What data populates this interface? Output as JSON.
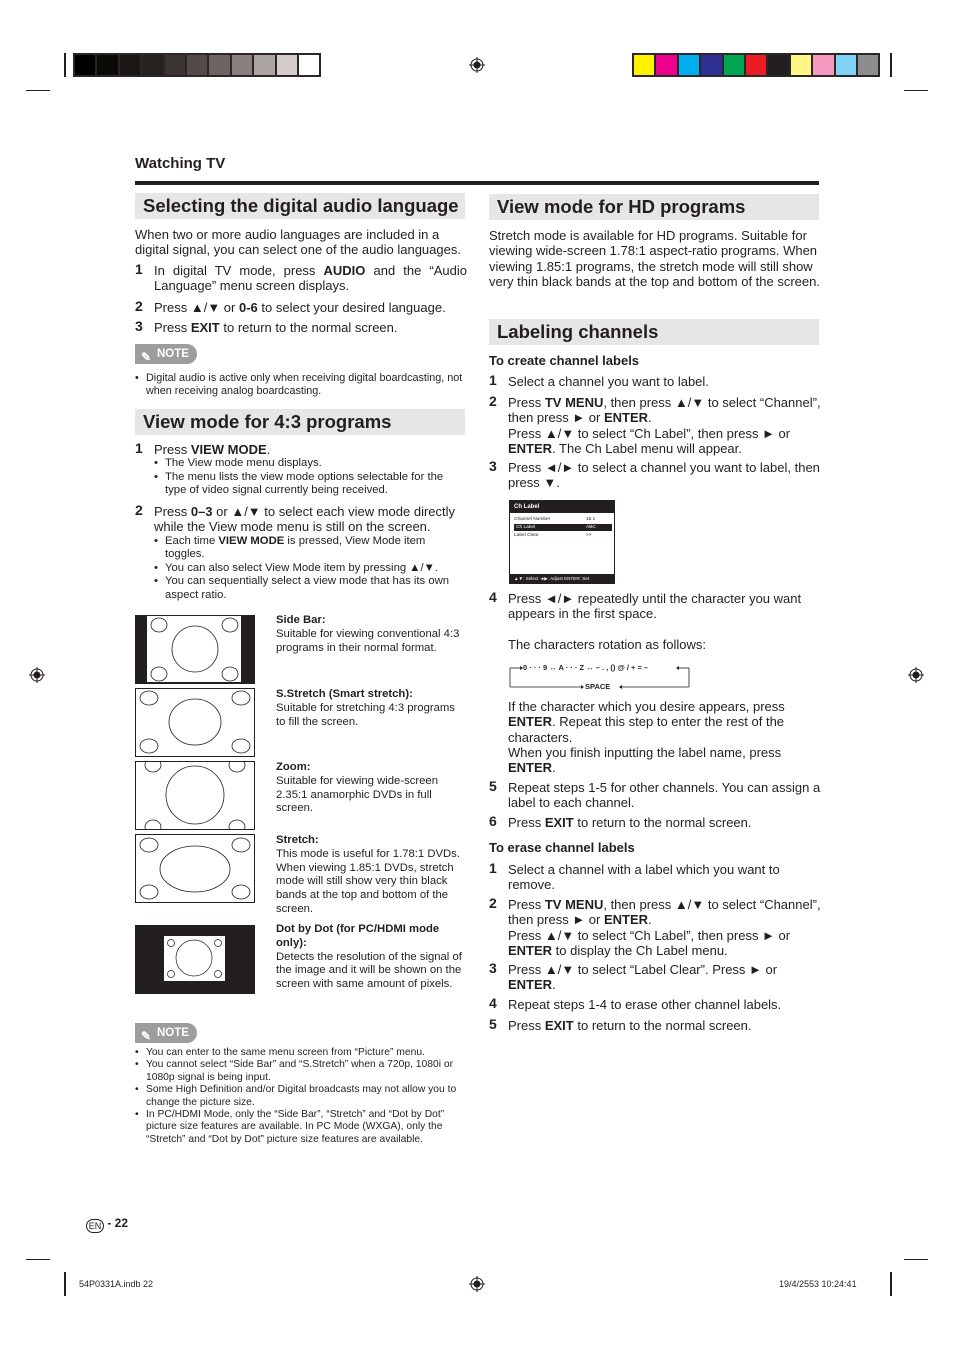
{
  "print_marks": {
    "gray_swatches": [
      "#000000",
      "#0c0a09",
      "#1a1615",
      "#262220",
      "#3b3432",
      "#544b48",
      "#6d6360",
      "#8a807c",
      "#aca4a1",
      "#d4cdcc",
      "#ffffff"
    ],
    "color_swatches": [
      "#fff100",
      "#ec008c",
      "#00aeef",
      "#2e3192",
      "#00a651",
      "#ed1c24",
      "#231f20",
      "#fff685",
      "#f49ac1",
      "#7fd3f7",
      "#8c8c8c"
    ]
  },
  "header": {
    "section": "Watching TV"
  },
  "left": {
    "audio": {
      "title": "Selecting the digital audio language",
      "intro": "When two or more audio languages are included in a digital signal, you can select one of the audio languages.",
      "steps": [
        {
          "n": "1",
          "pre": "In digital TV mode, press ",
          "key": "AUDIO",
          "post": " and the “Audio Language” menu screen displays."
        },
        {
          "n": "2",
          "pre": "Press ▲/▼ or ",
          "key": "0-6",
          "post": " to select your desired language."
        },
        {
          "n": "3",
          "pre": "Press ",
          "key": "EXIT",
          "post": " to return to the normal screen."
        }
      ],
      "note_label": "NOTE",
      "notes": [
        "Digital audio is active only when receiving digital boardcasting, not when receiving analog boardcasting."
      ]
    },
    "view43": {
      "title": "View mode for 4:3 programs",
      "step1": {
        "n": "1",
        "pre": "Press ",
        "key": "VIEW MODE",
        "post": ".",
        "bullets": [
          "The View mode menu displays.",
          "The menu lists the view mode options selectable for the type of video signal currently being received."
        ]
      },
      "step2": {
        "n": "2",
        "pre": "Press ",
        "key": "0–3",
        "post": " or ▲/▼ to select each view mode directly while the View mode menu is still on the screen.",
        "b1_pre": "Each time ",
        "b1_key": "VIEW MODE",
        "b1_post": " is pressed, View Mode item toggles.",
        "b2": "You can also select View Mode item by pressing ▲/▼.",
        "b3": "You can sequentially select a view mode that has its own aspect ratio."
      },
      "modes": [
        {
          "title": "Side Bar:",
          "desc": "Suitable for viewing conventional 4:3 programs in their normal format."
        },
        {
          "title": "S.Stretch (Smart stretch):",
          "desc": "Suitable for stretching 4:3 programs to fill the screen."
        },
        {
          "title": "Zoom:",
          "desc": "Suitable for viewing wide-screen 2.35:1 anamorphic DVDs in full screen."
        },
        {
          "title": "Stretch:",
          "desc": "This mode is useful for 1.78:1 DVDs. When viewing 1.85:1 DVDs, stretch mode will still show very thin black bands at the top and bottom of the screen."
        },
        {
          "title": "Dot by Dot (for PC/HDMI mode only):",
          "desc": "Detects the resolution of the signal of the image and it will be shown on the screen with same amount of pixels."
        }
      ],
      "note_label": "NOTE",
      "notes": [
        "You can enter to the same menu screen from “Picture” menu.",
        "You cannot select “Side Bar” and “S.Stretch” when a 720p, 1080i or 1080p signal is being input.",
        "Some High Definition and/or Digital broadcasts may not allow you to change the picture size.",
        "In PC/HDMI Mode, only the “Side Bar”, “Stretch” and “Dot by Dot” picture size features are available. In PC Mode (WXGA), only the “Stretch” and “Dot by Dot” picture size features are available."
      ]
    }
  },
  "right": {
    "hd": {
      "title": "View mode for HD programs",
      "body": "Stretch mode is available for HD programs. Suitable for viewing wide-screen 1.78:1 aspect-ratio programs. When viewing 1.85:1 programs, the stretch mode will still show very thin black bands at the top and bottom of the screen."
    },
    "label": {
      "title": "Labeling channels",
      "create_head": "To create channel labels",
      "c1": "Select a channel you want to label.",
      "c2a_pre": "Press ",
      "c2a_key": "TV MENU",
      "c2a_mid": ", then press ▲/▼ to select “Channel”, then press ► or ",
      "c2a_key2": "ENTER",
      "c2a_post": ".",
      "c2b_pre": "Press ▲/▼ to select “Ch Label”, then press ► or ",
      "c2b_key": "ENTER",
      "c2b_post": ". The Ch Label menu will appear.",
      "c3": "Press ◄/► to select a channel you want to label, then press ▼.",
      "menu": {
        "title": "Ch Label",
        "rows": [
          {
            "label": "Channel Number",
            "value": "15.1"
          },
          {
            "label": "Ch Label",
            "value": "ABC"
          },
          {
            "label": "Label Clear",
            "value": ">>"
          }
        ],
        "footer": "▲▼: Select   ◄▶: Adjust  ENTER: Set"
      },
      "c4": "Press ◄/► repeatedly until the character you want appears in the first space.",
      "rotation_intro": "The characters rotation as follows:",
      "rotation_seq": "0 · · · 9 ↔ A · · · Z ↔ – . , () @ / + = –",
      "rotation_space": "SPACE",
      "c4b_pre": "If the character which you desire appears, press ",
      "c4b_key": "ENTER",
      "c4b_post": ". Repeat this step to enter the rest of the characters.",
      "c4c_pre": "When you finish inputting the label name, press ",
      "c4c_key": "ENTER",
      "c4c_post": ".",
      "c5": "Repeat steps 1-5 for other channels. You can assign a label to each channel.",
      "c6_pre": "Press ",
      "c6_key": "EXIT",
      "c6_post": " to return to the normal screen.",
      "erase_head": "To erase channel labels",
      "e1": "Select a channel with a label which you want to remove.",
      "e2a_pre": "Press ",
      "e2a_key": "TV MENU",
      "e2a_mid": ", then press ▲/▼ to select “Channel”, then press ► or ",
      "e2a_key2": "ENTER",
      "e2a_post": ".",
      "e2b_pre": "Press ▲/▼ to select “Ch Label”, then press ► or ",
      "e2b_key": "ENTER",
      "e2b_post": " to display the Ch Label menu.",
      "e3_pre": "Press ▲/▼ to select “Label Clear”. Press ► or ",
      "e3_key": "ENTER",
      "e3_post": ".",
      "e4": "Repeat steps 1-4 to erase other channel labels.",
      "e5_pre": "Press ",
      "e5_key": "EXIT",
      "e5_post": " to return to the normal screen."
    }
  },
  "footer": {
    "lang": "EN",
    "page": "- 22",
    "file": "54P0331A.indb   22",
    "timestamp": "19/4/2553   10:24:41"
  }
}
